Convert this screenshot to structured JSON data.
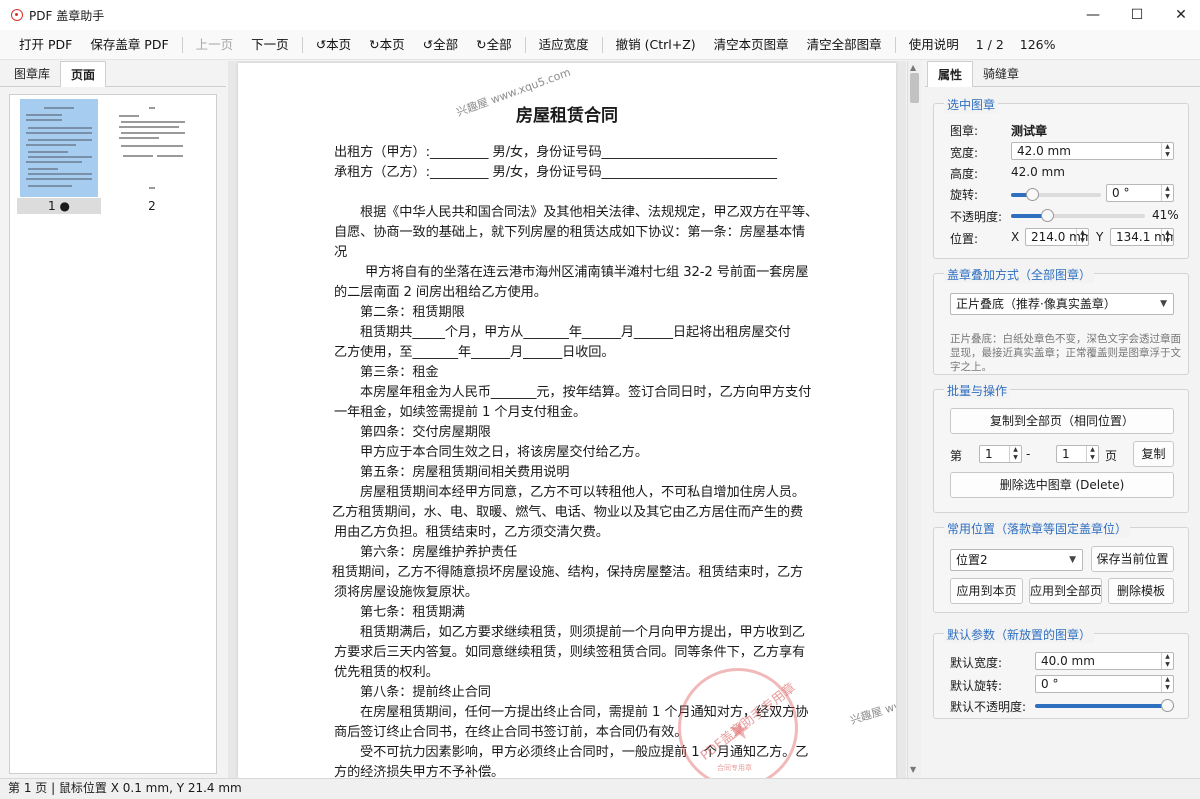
{
  "window": {
    "title": "PDF 盖章助手",
    "minimize": "—",
    "maximize": "☐",
    "close": "✕"
  },
  "toolbar": {
    "open": "打开 PDF",
    "save": "保存盖章 PDF",
    "prev": "上一页",
    "next": "下一页",
    "rot_page_ccw": "↺本页",
    "rot_page_cw": "↻本页",
    "rot_all_ccw": "↺全部",
    "rot_all_cw": "↻全部",
    "fit_width": "适应宽度",
    "undo": "撤销 (Ctrl+Z)",
    "clear_page": "清空本页图章",
    "clear_all": "清空全部图章",
    "help": "使用说明",
    "page_indicator": "1 / 2",
    "zoom": "126%"
  },
  "left": {
    "tabs": [
      "图章库",
      "页面"
    ],
    "active_tab": "页面",
    "thumbs": [
      {
        "label": "1 ●"
      },
      {
        "label": "2"
      }
    ]
  },
  "document": {
    "title": "房屋租赁合同",
    "lines": [
      "出租方（甲方）:_________ 男/女，身份证号码___________________________",
      "承租方（乙方）:_________ 男/女，身份证号码___________________________",
      "根据《中华人民共和国合同法》及其他相关法律、法规规定，甲乙双方在平等、",
      "自愿、协商一致的基础上，就下列房屋的租赁达成如下协议：第一条：房屋基本情",
      "况",
      "甲方将自有的坐落在连云港市海州区浦南镇半滩村七组 32-2 号前面一套房屋",
      "的二层南面 2 间房出租给乙方使用。",
      "第二条：租赁期限",
      "租赁期共_____个月，甲方从_______年______月______日起将出租房屋交付",
      "乙方使用，至_______年______月______日收回。",
      "第三条：租金",
      "本房屋年租金为人民币_______元，按年结算。签订合同日时，乙方向甲方支付",
      "一年租金，如续签需提前 1 个月支付租金。",
      "第四条：交付房屋期限",
      "甲方应于本合同生效之日，将该房屋交付给乙方。",
      "第五条：房屋租赁期间相关费用说明",
      "房屋租赁期间本经甲方同意，乙方不可以转租他人，不可私自增加住房人员。",
      "乙方租赁期间，水、电、取暖、燃气、电话、物业以及其它由乙方居住而产生的费",
      "用由乙方负担。租赁结束时，乙方须交清欠费。",
      "第六条：房屋维护养护责任",
      "租赁期间，乙方不得随意损坏房屋设施、结构，保持房屋整洁。租赁结束时，乙方",
      "须将房屋设施恢复原状。",
      "第七条：租赁期满",
      "租赁期满后，如乙方要求继续租赁，则须提前一个月向甲方提出，甲方收到乙",
      "方要求后三天内答复。如同意继续租赁，则续签租赁合同。同等条件下，乙方享有",
      "优先租赁的权利。",
      "第八条：提前终止合同",
      "在房屋租赁期间，任何一方提出终止合同，需提前 1 个月通知对方，经双方协",
      "商后签订终止合同书，在终止合同书签订前，本合同仍有效。",
      "受不可抗力因素影响，甲方必须终止合同时，一般应提前 1 个月通知乙方。乙",
      "方的经济损失甲方不予补偿。"
    ],
    "watermark": "兴趣屋 www.xqu5.com",
    "stamp_text": "PDF盖章助手专用章",
    "stamp_sub": "合同专用章"
  },
  "right": {
    "tabs": [
      "属性",
      "骑缝章"
    ],
    "active_tab": "属性",
    "selected": {
      "title": "选中图章",
      "stamp_label": "图章:",
      "stamp_name": "测试章",
      "width_label": "宽度:",
      "width": "42.0 mm",
      "height_label": "高度:",
      "height": "42.0 mm",
      "rotate_label": "旋转:",
      "rotate": "0 °",
      "rotate_fraction": 0.23,
      "opacity_label": "不透明度:",
      "opacity": "41%",
      "opacity_fraction": 0.27,
      "pos_label": "位置:",
      "x_label": "X",
      "x": "214.0 mm",
      "y_label": "Y",
      "y": "134.1 mm"
    },
    "blend": {
      "title": "盖章叠加方式（全部图章）",
      "mode": "正片叠底（推荐·像真实盖章）",
      "desc": "正片叠底：白纸处章色不变，深色文字会透过章面显现，最接近真实盖章；正常覆盖则是图章浮于文字之上。"
    },
    "batch": {
      "title": "批量与操作",
      "copy_all": "复制到全部页（相同位置）",
      "from_label": "第",
      "from": "1",
      "dash": "-",
      "to": "1",
      "page_label": "页",
      "copy": "复制",
      "delete": "删除选中图章 (Delete)"
    },
    "positions": {
      "title": "常用位置（落款章等固定盖章位）",
      "selected": "位置2",
      "save_current": "保存当前位置",
      "apply_page": "应用到本页",
      "apply_all": "应用到全部页",
      "delete_template": "删除模板"
    },
    "defaults": {
      "title": "默认参数（新放置的图章）",
      "width_label": "默认宽度:",
      "width": "40.0 mm",
      "rotate_label": "默认旋转:",
      "rotate": "0 °",
      "opacity_label": "默认不透明度:",
      "opacity_fraction": 1.0
    }
  },
  "status": {
    "text": "第 1 页 | 鼠标位置 X 0.1 mm, Y 21.4 mm"
  },
  "colors": {
    "accent": "#2f6fc0",
    "stamp": "#d9342b",
    "thumb_selected": "#a6ccf0"
  }
}
